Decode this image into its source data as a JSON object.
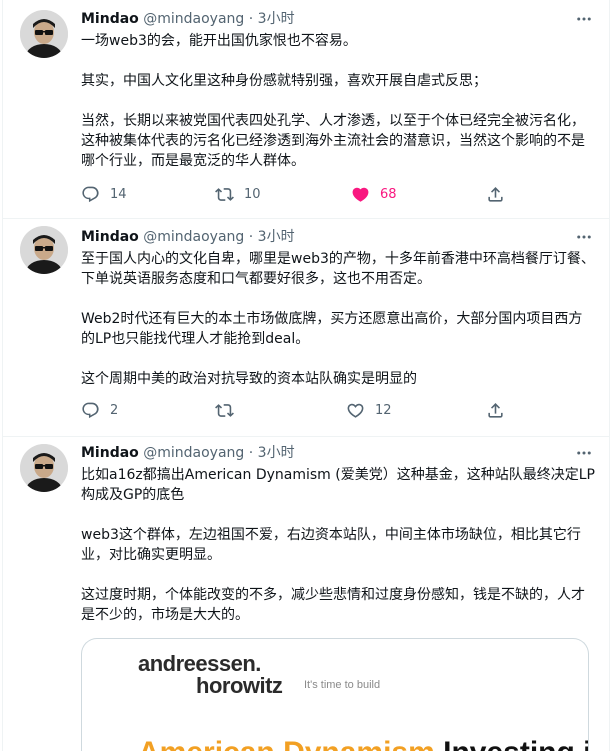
{
  "author": {
    "name": "Mindao",
    "handle": "@mindaoyang",
    "separator": "·"
  },
  "tweets": [
    {
      "time": "3小时",
      "paragraphs": [
        "一场web3的会，能开出国仇家恨也不容易。",
        "其实，中国人文化里这种身份感就特别强，喜欢开展自虐式反思；",
        "当然，长期以来被党国代表四处孔学、人才渗透，以至于个体已经完全被污名化，这种被集体代表的污名化已经渗透到海外主流社会的潜意识，当然这个影响的不是哪个行业，而是最宽泛的华人群体。"
      ],
      "replies": "14",
      "retweets": "10",
      "likes": "68",
      "liked": true
    },
    {
      "time": "3小时",
      "paragraphs": [
        "至于国人内心的文化自卑，哪里是web3的产物，十多年前香港中环高档餐厅订餐、下单说英语服务态度和口气都要好很多，这也不用否定。",
        "Web2时代还有巨大的本土市场做底牌，买方还愿意出高价，大部分国内项目西方的LP也只能找代理人才能抢到deal。",
        "这个周期中美的政治对抗导致的资本站队确实是明显的"
      ],
      "replies": "2",
      "retweets": "",
      "likes": "12",
      "liked": false
    },
    {
      "time": "3小时",
      "paragraphs": [
        "比如a16z都搞出American Dynamism (爱美党）这种基金，这种站队最终决定LP构成及GP的底色",
        "web3这个群体，左边祖国不爱，右边资本站队，中间主体市场缺位，相比其它行业，对比确实更明显。",
        "这过度时期，个体能改变的不多，减少些悲情和过度身份感知，钱是不缺的，人才是不少的，市场是大大的。"
      ],
      "card": {
        "logo_line1": "andreessen.",
        "logo_line2": "horowitz",
        "tagline": "It's time to build",
        "headline_orange": "American Dynamism",
        "headline_dark": " Investing in"
      }
    }
  ],
  "icons": {
    "more": "more-dots-icon",
    "reply": "reply-icon",
    "retweet": "retweet-icon",
    "like": "heart-icon",
    "share": "share-icon"
  },
  "colors": {
    "text": "#0f1419",
    "muted": "#536471",
    "like_active": "#f91880",
    "card_orange": "#f2a023"
  }
}
